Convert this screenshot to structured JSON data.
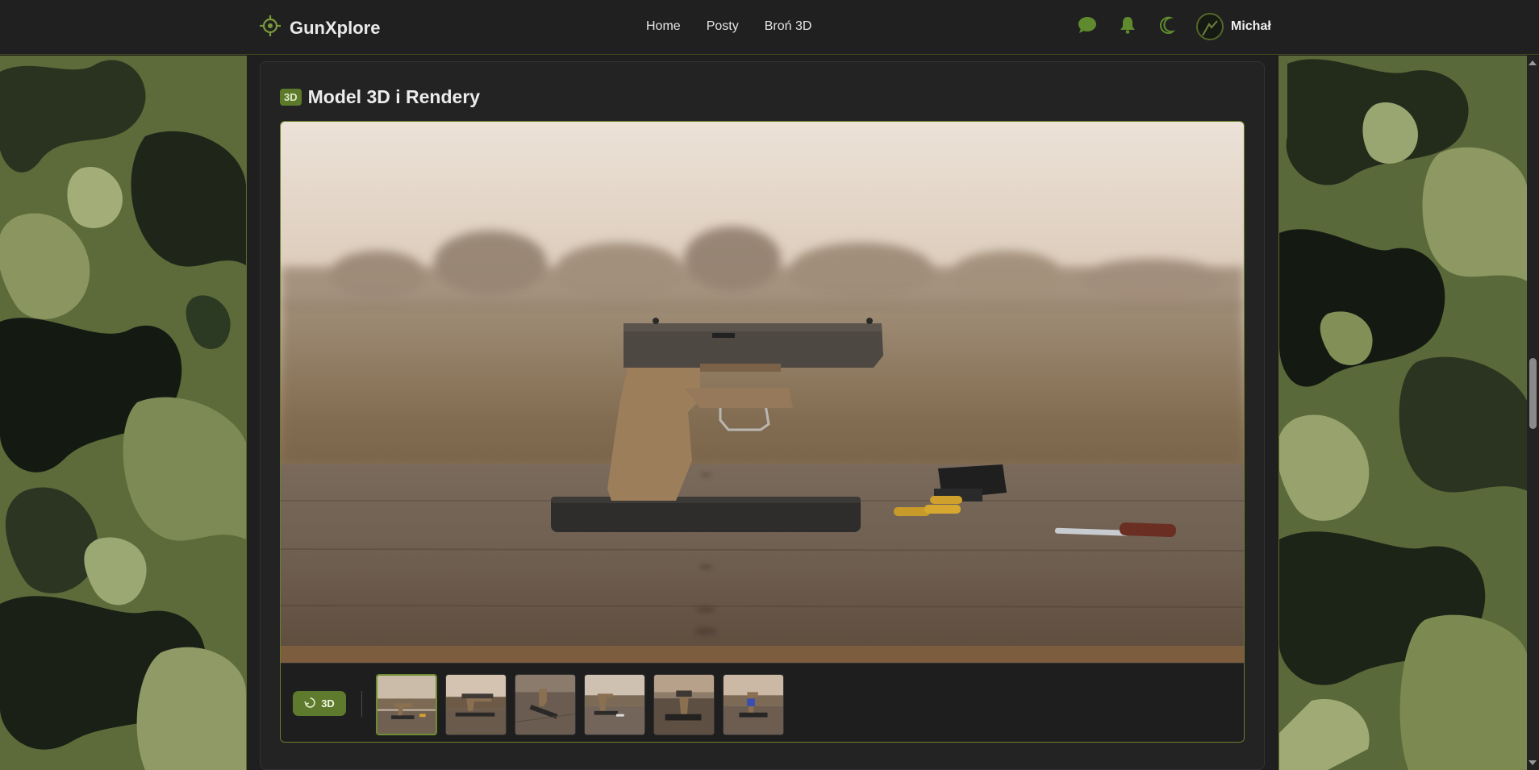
{
  "header": {
    "brand": "GunXplore",
    "brand_icon": "crosshair-icon",
    "nav": [
      {
        "label": "Home"
      },
      {
        "label": "Posty"
      },
      {
        "label": "Broń 3D"
      }
    ],
    "actions": [
      "chat-icon",
      "bell-icon",
      "moon-icon"
    ],
    "user_name": "Michał"
  },
  "section": {
    "badge": "3D",
    "title": "Model 3D i Rendery"
  },
  "viewer": {
    "button_3d_label": "3D",
    "thumbnail_count": 6,
    "active_thumbnail": 0
  },
  "colors": {
    "accent": "#5e7a2d",
    "header_bg": "#202020",
    "page_bg": "#1f1f1f",
    "border_accent": "#6b7f2c"
  }
}
